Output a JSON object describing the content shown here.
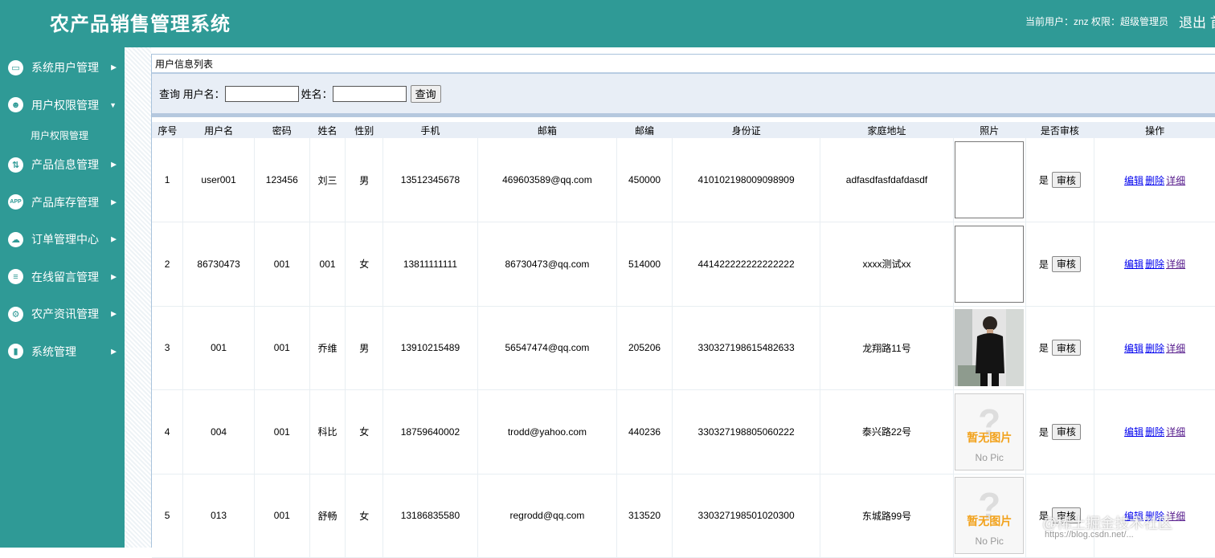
{
  "header": {
    "title": "农产品销售管理系统",
    "user_info": "当前用户：znz  权限：超级管理员",
    "logout": "退出 首"
  },
  "sidebar": {
    "items": [
      {
        "label": "系统用户管理",
        "icon": "monitor-icon"
      },
      {
        "label": "用户权限管理",
        "icon": "user-gear-icon",
        "expanded": true,
        "sub": [
          "用户权限管理"
        ]
      },
      {
        "label": "产品信息管理",
        "icon": "arrows-icon"
      },
      {
        "label": "产品库存管理",
        "icon": "app-icon"
      },
      {
        "label": "订单管理中心",
        "icon": "cloud-icon"
      },
      {
        "label": "在线留言管理",
        "icon": "stack-icon"
      },
      {
        "label": "农产资讯管理",
        "icon": "settings-icon"
      },
      {
        "label": "系统管理",
        "icon": "chart-icon"
      }
    ]
  },
  "panel": {
    "title": "用户信息列表",
    "search": {
      "label_query": "查询 用户名：",
      "label_name": "姓名：",
      "username_value": "",
      "name_value": "",
      "button": "查询"
    }
  },
  "table": {
    "columns": [
      "序号",
      "用户名",
      "密码",
      "姓名",
      "性别",
      "手机",
      "邮箱",
      "邮编",
      "身份证",
      "家庭地址",
      "照片",
      "是否审核",
      "操作"
    ],
    "rows": [
      {
        "no": "1",
        "username": "user001",
        "password": "123456",
        "name": "刘三",
        "gender": "男",
        "phone": "13512345678",
        "email": "469603589@qq.com",
        "zip": "450000",
        "id_card": "410102198009098909",
        "address": "adfasdfasfdafdasdf",
        "photo": "blank",
        "audit": "是",
        "audit_btn": "审核",
        "ops": [
          "编辑",
          "删除",
          "详细"
        ]
      },
      {
        "no": "2",
        "username": "86730473",
        "password": "001",
        "name": "001",
        "gender": "女",
        "phone": "13811111111",
        "email": "86730473@qq.com",
        "zip": "514000",
        "id_card": "441422222222222222",
        "address": "xxxx测试xx",
        "photo": "blank",
        "audit": "是",
        "audit_btn": "审核",
        "ops": [
          "编辑",
          "删除",
          "详细"
        ]
      },
      {
        "no": "3",
        "username": "001",
        "password": "001",
        "name": "乔维",
        "gender": "男",
        "phone": "13910215489",
        "email": "56547474@qq.com",
        "zip": "205206",
        "id_card": "330327198615482633",
        "address": "龙翔路11号",
        "photo": "person",
        "audit": "是",
        "audit_btn": "审核",
        "ops": [
          "编辑",
          "删除",
          "详细"
        ]
      },
      {
        "no": "4",
        "username": "004",
        "password": "001",
        "name": "科比",
        "gender": "女",
        "phone": "18759640002",
        "email": "trodd@yahoo.com",
        "zip": "440236",
        "id_card": "330327198805060222",
        "address": "泰兴路22号",
        "photo": "nopic",
        "audit": "是",
        "audit_btn": "审核",
        "ops": [
          "编辑",
          "删除",
          "详细"
        ]
      },
      {
        "no": "5",
        "username": "013",
        "password": "001",
        "name": "舒畅",
        "gender": "女",
        "phone": "13186835580",
        "email": "regrodd@qq.com",
        "zip": "313520",
        "id_card": "330327198501020300",
        "address": "东城路99号",
        "photo": "nopic",
        "audit": "是",
        "audit_btn": "审核",
        "ops": [
          "编辑",
          "删除",
          "详细"
        ]
      }
    ],
    "nopic_text": "暂无图片",
    "nopic_sub": "No Pic",
    "nopic_mark": "?"
  },
  "watermark": {
    "main": "@稀土掘金技术社区",
    "url": "https://blog.csdn.net/..."
  },
  "colors": {
    "brand": "#2f9a96",
    "panel_bg": "#e8eef6",
    "link": "#0000ee"
  }
}
